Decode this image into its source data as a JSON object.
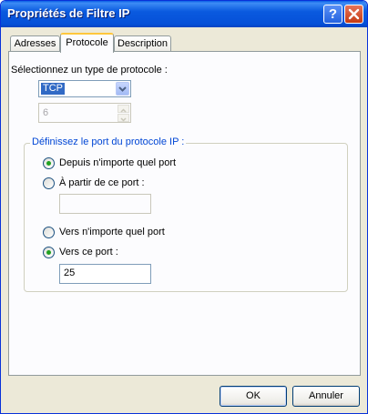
{
  "window": {
    "title": "Propriétés de Filtre IP"
  },
  "titlebar_buttons": {
    "help": "?",
    "close_icon": "close-x-icon"
  },
  "tabs": [
    {
      "label": "Adresses",
      "selected": false
    },
    {
      "label": "Protocole",
      "selected": true
    },
    {
      "label": "Description",
      "selected": false
    }
  ],
  "protocol": {
    "select_label": "Sélectionnez un type de protocole :",
    "type_value": "TCP",
    "number_value": "6"
  },
  "port_group": {
    "title": "Définissez le port du protocole IP :",
    "from_any": {
      "label": "Depuis n'importe quel port",
      "checked": true
    },
    "from_port": {
      "label": "À partir de ce port :",
      "checked": false,
      "value": ""
    },
    "to_any": {
      "label": "Vers n'importe quel port",
      "checked": false
    },
    "to_port": {
      "label": "Vers ce port :",
      "checked": true,
      "value": "25"
    }
  },
  "buttons": {
    "ok": "OK",
    "cancel": "Annuler"
  }
}
